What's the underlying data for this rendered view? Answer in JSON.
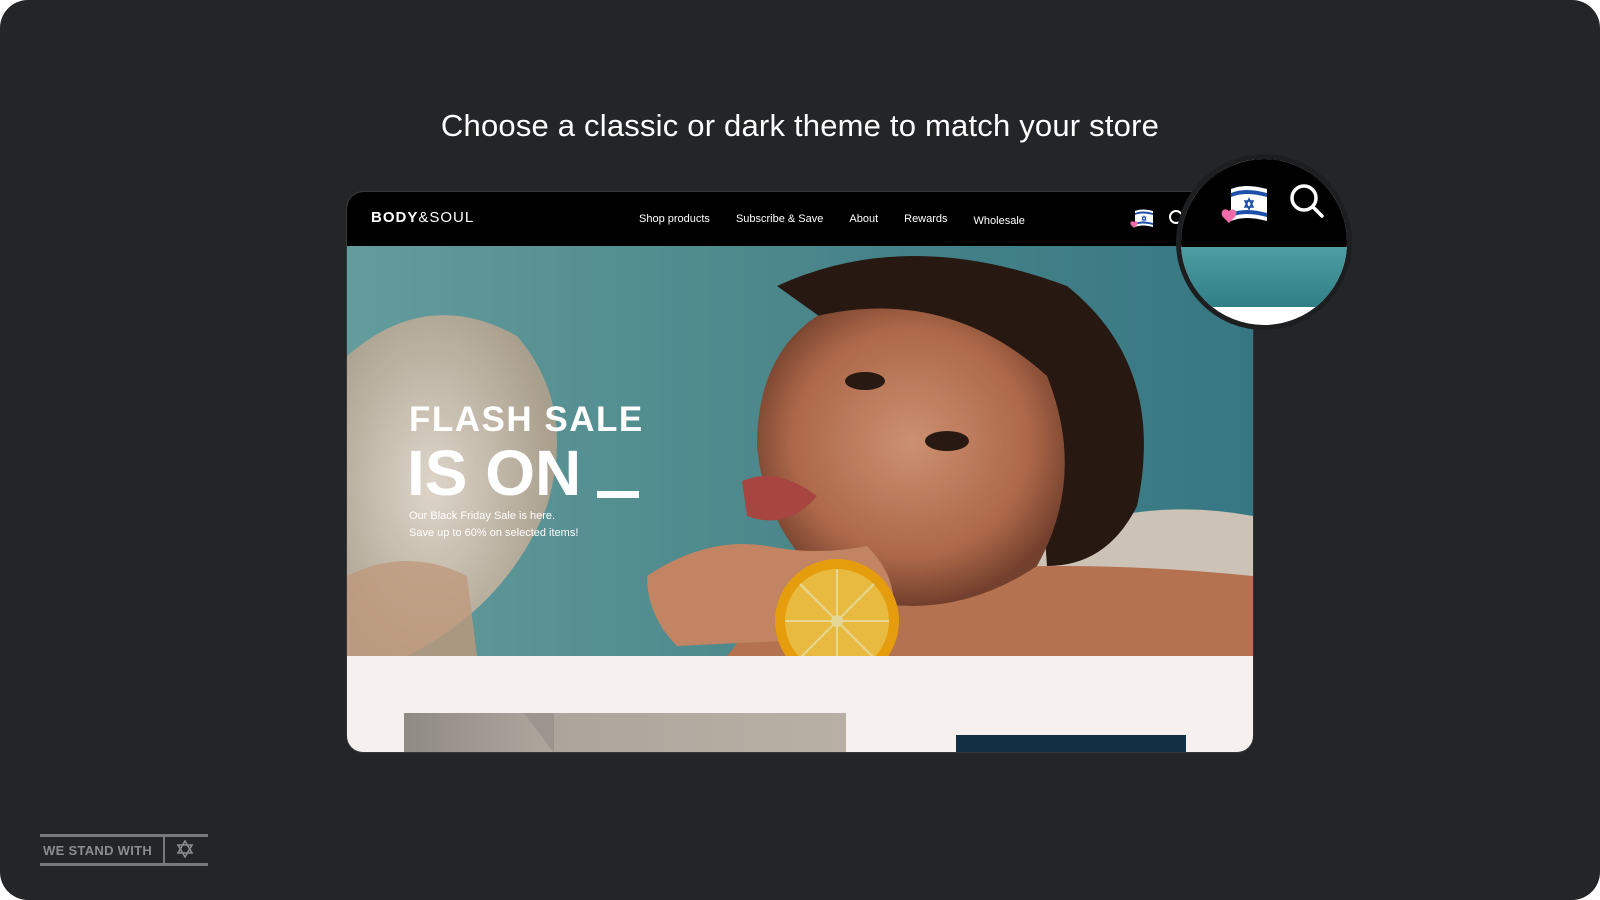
{
  "headline": "Choose a classic or dark theme to match your store",
  "store": {
    "logo_bold": "BODY",
    "logo_light": "&SOUL",
    "nav": [
      "Shop products",
      "Subscribe & Save",
      "About",
      "Rewards",
      "Wholesale"
    ],
    "icons": [
      "israel-flag-heart-icon",
      "search-icon"
    ],
    "hero": {
      "title_line1": "FLASH SALE",
      "title_line2": "IS ON",
      "subtitle_line1": "Our Black Friday Sale is here.",
      "subtitle_line2": "Save up to 60% on selected items!"
    }
  },
  "badge": {
    "text": "WE STAND WITH",
    "icon": "star-of-david-icon"
  },
  "colors": {
    "background": "#242527",
    "nav_bar": "#000000",
    "page_bg": "#f6f1ee",
    "accent_dark": "#123043",
    "flag_blue": "#1d4fa8",
    "heart_pink": "#f06ba8"
  }
}
